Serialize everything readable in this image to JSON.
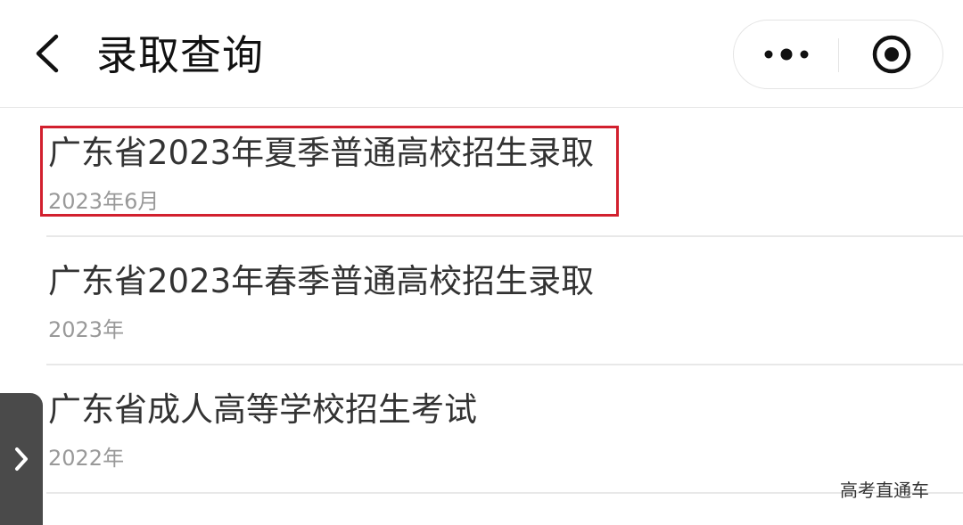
{
  "header": {
    "title": "录取查询",
    "back_icon": "chevron-left-icon",
    "more_icon": "more-dots-icon",
    "close_icon": "target-circle-icon"
  },
  "list": {
    "items": [
      {
        "title": "广东省2023年夏季普通高校招生录取",
        "date": "2023年6月",
        "highlighted": true
      },
      {
        "title": "广东省2023年春季普通高校招生录取",
        "date": "2023年",
        "highlighted": false
      },
      {
        "title": "广东省成人高等学校招生考试",
        "date": "2022年",
        "highlighted": false
      }
    ]
  },
  "side_tab": {
    "icon": "chevron-right-icon"
  },
  "watermark": {
    "text": "高考直通车"
  },
  "colors": {
    "highlight": "#d2202e",
    "title_text": "#333333",
    "date_text": "#999999",
    "side_tab": "#4a4a4a"
  }
}
